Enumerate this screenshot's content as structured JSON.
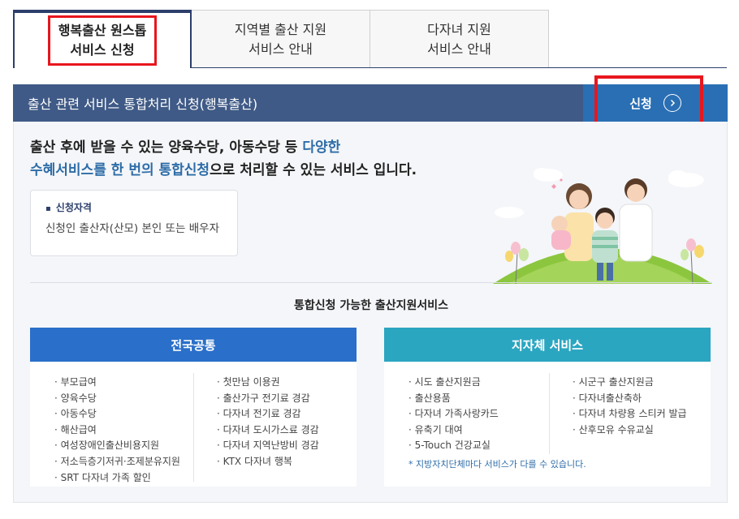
{
  "tabs": [
    {
      "line1": "행복출산 원스톱",
      "line2": "서비스 신청"
    },
    {
      "line1": "지역별 출산 지원",
      "line2": "서비스 안내"
    },
    {
      "line1": "다자녀 지원",
      "line2": "서비스 안내"
    }
  ],
  "service": {
    "title": "출산 관련 서비스 통합처리 신청(행복출산)",
    "apply_label": "신청",
    "apply_icon": "arrow-right-circle-icon"
  },
  "intro": {
    "line1_plain": "출산 후에 받을 수 있는 양육수당, 아동수당 등 ",
    "line1_accent": "다양한",
    "line2_accent": "수혜서비스를 한 번의 통합신청",
    "line2_plain": "으로 처리할 수 있는 서비스 입니다."
  },
  "qualification": {
    "label": "신청자격",
    "text": "신청인 출산자(산모) 본인 또는 배우자"
  },
  "services_title": "통합신청 가능한 출산지원서비스",
  "national": {
    "title": "전국공통",
    "col_a": [
      "부모급여",
      "양육수당",
      "아동수당",
      "해산급여",
      "여성장애인출산비용지원",
      "저소득층기저귀·조제분유지원",
      "SRT 다자녀 가족 할인"
    ],
    "col_b": [
      "첫만남 이용권",
      "출산가구 전기료 경감",
      "다자녀 전기료 경감",
      "다자녀 도시가스료 경감",
      "다자녀 지역난방비 경감",
      "KTX 다자녀 행복"
    ]
  },
  "local": {
    "title": "지자체 서비스",
    "col_a": [
      "시도 출산지원금",
      "출산용품",
      "다자녀 가족사랑카드",
      "유축기 대여",
      "5-Touch 건강교실"
    ],
    "col_b": [
      "시군구 출산지원금",
      "다자녀출산축하",
      "다자녀 차량용 스티커 발급",
      "산후모유 수유교실"
    ],
    "note": "* 지방자치단체마다 서비스가 다를 수 있습니다."
  },
  "colors": {
    "header_bar": "#3f5a86",
    "apply_button": "#2a6fb4",
    "national_head": "#2a6fc9",
    "local_head": "#2ba6c1",
    "accent_text": "#2d6ca7",
    "highlight_red": "#e8161d"
  }
}
